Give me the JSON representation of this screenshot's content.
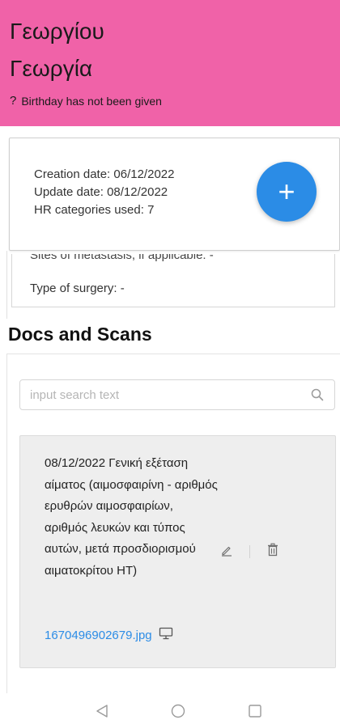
{
  "patient": {
    "name_line1": "Γεωργίου",
    "name_line2": "Γεωργία",
    "birthday_icon": "question-mark-icon",
    "birthday_text": "Birthday has not been given"
  },
  "record_info": {
    "creation": "Creation date: 06/12/2022",
    "update": "Update date: 08/12/2022",
    "categories": "HR categories used: 7"
  },
  "fab": {
    "label": "+",
    "icon": "plus-icon"
  },
  "history": {
    "metastasis_partial": "Sites of metastasis, if applicable: -",
    "surgery": "Type of surgery: -"
  },
  "docs": {
    "title": "Docs and Scans",
    "search_placeholder": "input search text",
    "search_value": "",
    "items": [
      {
        "description": "08/12/2022 Γενική εξέταση αίματος (αιμοσφαιρίνη - αριθμός ερυθρών αιμοσφαιρίων, αριθμός λευκών και τύπος αυτών, μετά προσδιορισμού αιματοκρίτου HT)",
        "filename": "1670496902679.jpg"
      }
    ]
  },
  "colors": {
    "header_bg": "#f062a8",
    "accent": "#2b8ce6",
    "card_bg": "#eeeeee"
  },
  "icons": {
    "edit": "pencil-icon",
    "delete": "trash-icon",
    "preview": "monitor-icon",
    "search": "search-icon",
    "nav_back": "triangle-back-icon",
    "nav_home": "circle-home-icon",
    "nav_recent": "square-recents-icon"
  }
}
